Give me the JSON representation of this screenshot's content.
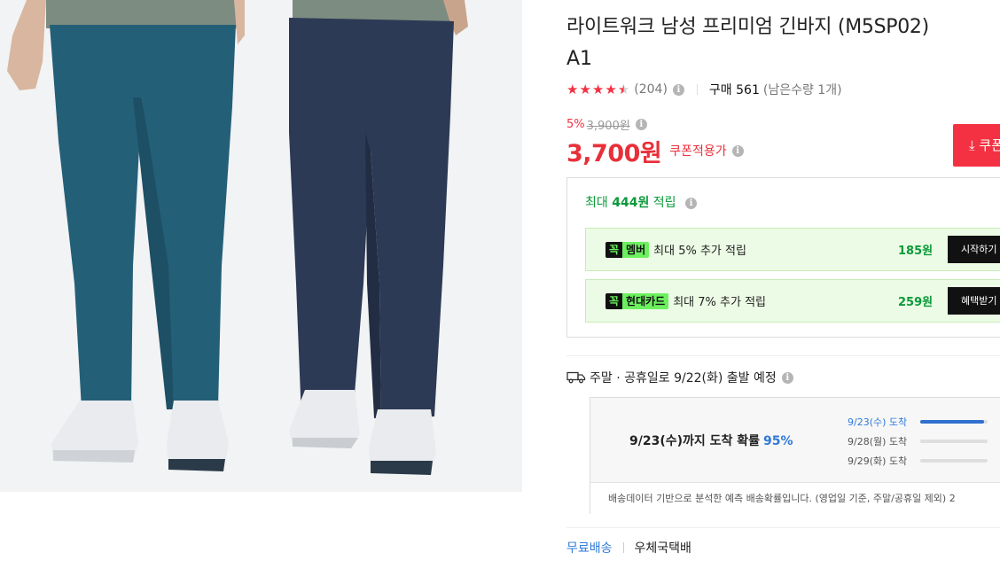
{
  "product": {
    "title_line1": "라이트워크 남성 프리미엄 긴바지 (M5SP02)",
    "title_line2": "A1",
    "review_count": "(204)",
    "rating": 4.5,
    "purchase_label": "구매 561",
    "remaining": "(남은수량 1개)"
  },
  "price": {
    "discount_rate": "5%",
    "original_price": "3,900원",
    "final_price": "3,700원",
    "coupon_label": "쿠폰적용가",
    "coupon_button": "⤓ 쿠폰"
  },
  "points": {
    "max_prefix": "최대",
    "max_amount": "444원",
    "max_suffix": "적립",
    "benefits": [
      {
        "badge_k": "꼭",
        "badge_text": "멤버",
        "desc": "최대 5% 추가 적립",
        "amount": "185원",
        "button": "시작하기"
      },
      {
        "badge_k": "꼭",
        "badge_text": "현대카드",
        "desc": "최대 7% 추가 적립",
        "amount": "259원",
        "button": "혜택받기"
      }
    ]
  },
  "shipping": {
    "notice": "주말 · 공휴일로 9/22(화) 출발 예정",
    "probability_text": "9/23(수)까지 도착 확률",
    "probability_pct": "95%",
    "arrivals": [
      {
        "label": "9/23(수) 도착",
        "fraction": 0.95
      },
      {
        "label": "9/28(월) 도착",
        "fraction": 0.0
      },
      {
        "label": "9/29(화) 도착",
        "fraction": 0.0
      }
    ],
    "footer": "배송데이터 기반으로 분석한 예측 배송확률입니다. (영업일 기준, 주말/공휴일 제외) 2",
    "free_shipping": "무료배송",
    "carrier": "우체국택배"
  },
  "colors": {
    "accent_red": "#f43142",
    "points_green": "#0b9a3a",
    "link_blue": "#2f7ad8"
  }
}
